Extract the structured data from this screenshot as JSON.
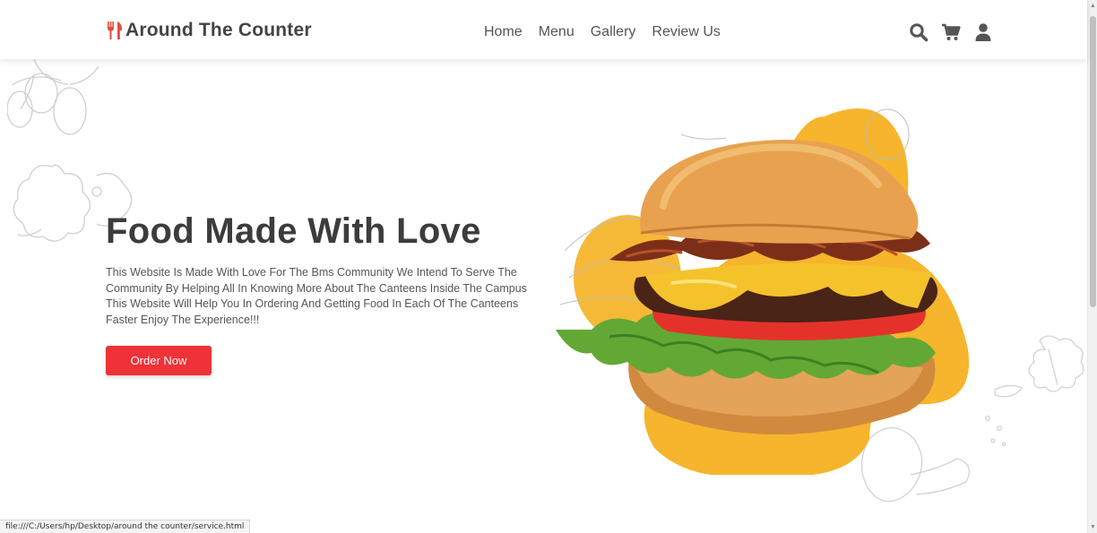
{
  "header": {
    "logo_text": "Around The Counter",
    "nav": [
      {
        "label": "Home"
      },
      {
        "label": "Menu"
      },
      {
        "label": "Gallery"
      },
      {
        "label": "Review Us"
      }
    ],
    "icons": [
      "search-icon",
      "cart-icon",
      "user-icon"
    ]
  },
  "hero": {
    "title": "Food Made With Love",
    "description": "This Website Is Made With Love For The Bms Community We Intend To Serve The Community By Helping All In Knowing More About The Canteens Inside The Campus This Website Will Help You In Ordering And Getting Food In Each Of The Canteens Faster Enjoy The Experience!!!",
    "cta_label": "Order Now"
  },
  "status_bar": {
    "url": "file:///C:/Users/hp/Desktop/around the counter/service.html"
  },
  "colors": {
    "accent_red": "#ef3237",
    "logo_red": "#e84a3f",
    "blob_yellow": "#f6b52c"
  }
}
